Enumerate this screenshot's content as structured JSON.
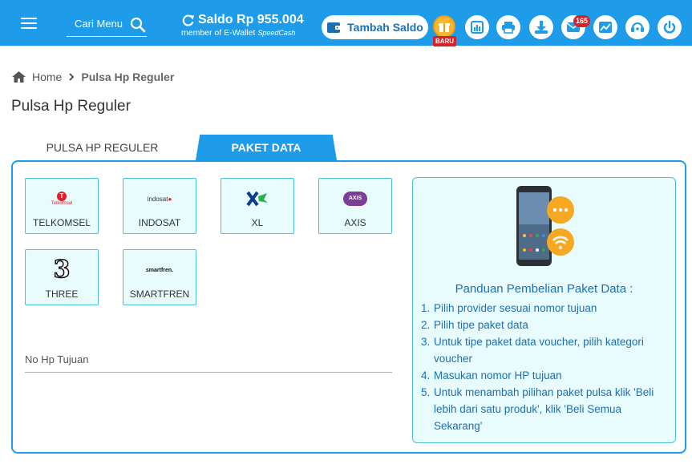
{
  "header": {
    "search_placeholder": "Cari Menu",
    "saldo": "Saldo Rp 955.004",
    "member_text": "member of E-Wallet",
    "brand": "SpeedCash",
    "tambah_saldo": "Tambah Saldo",
    "baru": "BARU",
    "mail_count": "165",
    "accent": "#1e9be9",
    "icons": [
      "menu-icon",
      "search-icon",
      "refresh-icon",
      "wallet-icon",
      "gift-icon",
      "chart-icon",
      "printer-icon",
      "download-icon",
      "mail-icon",
      "trend-icon",
      "headset-icon",
      "power-icon"
    ]
  },
  "breadcrumb": {
    "home": "Home",
    "current": "Pulsa Hp Reguler"
  },
  "page_title": "Pulsa Hp Reguler",
  "tabs": {
    "reguler": "PULSA HP REGULER",
    "data": "PAKET DATA"
  },
  "providers": [
    {
      "name": "TELKOMSEL",
      "logo_text": "Telkomsel",
      "color": "#e41e26"
    },
    {
      "name": "INDOSAT",
      "logo_text": "indosat",
      "color": "#333333"
    },
    {
      "name": "XL",
      "logo_text": "XL",
      "color": "#0a3d91"
    },
    {
      "name": "AXIS",
      "logo_text": "AXIS",
      "color": "#7b3f98"
    },
    {
      "name": "THREE",
      "logo_text": "3",
      "color": "#111111"
    },
    {
      "name": "SMARTFREN",
      "logo_text": "smartfren.",
      "color": "#111111"
    }
  ],
  "form": {
    "phone_label": "No Hp Tujuan"
  },
  "guide": {
    "title": "Panduan Pembelian Paket Data :",
    "steps": [
      {
        "num": "1.",
        "text": "Pilih provider sesuai nomor tujuan"
      },
      {
        "num": "2.",
        "text": "Pilih tipe paket data"
      },
      {
        "num": "3.",
        "text": "Untuk tipe paket data voucher, pilih kategori voucher"
      },
      {
        "num": "4.",
        "text": "Masukan nomor HP tujuan"
      },
      {
        "num": "5.",
        "text": "Untuk menambah pilihan paket pulsa klik 'Beli lebih dari satu produk', klik 'Beli Semua Sekarang'"
      }
    ]
  }
}
